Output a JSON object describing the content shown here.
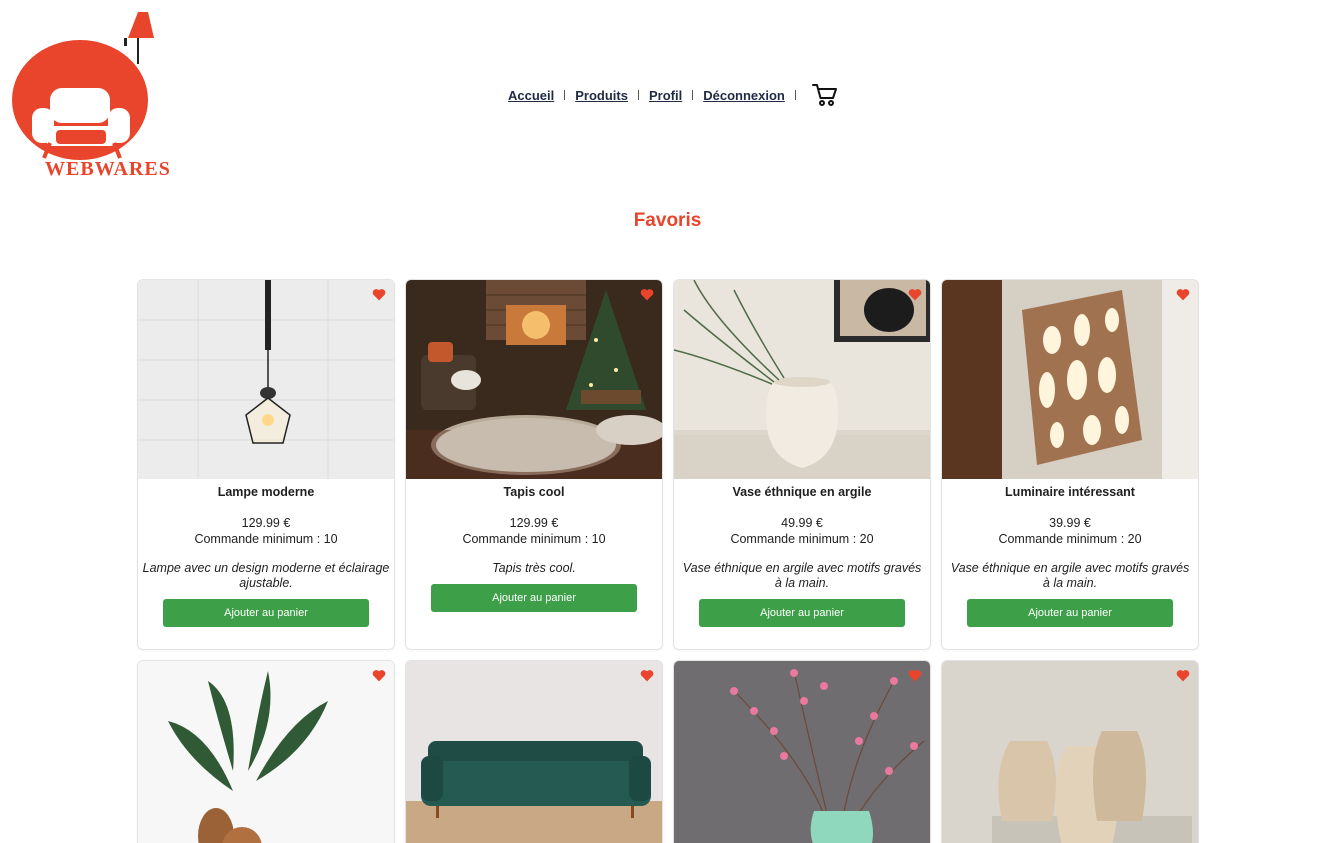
{
  "brand": {
    "name_part1": "WEB",
    "name_part2": "WARES",
    "accent": "#e8452c"
  },
  "nav": {
    "items": [
      {
        "label": "Accueil"
      },
      {
        "label": "Produits"
      },
      {
        "label": "Profil"
      },
      {
        "label": "Déconnexion"
      }
    ],
    "cart_icon": "cart-icon"
  },
  "page": {
    "title": "Favoris"
  },
  "products": [
    {
      "name": "Lampe moderne",
      "price": "129.99 €",
      "min_order": "Commande minimum : 10",
      "description": "Lampe avec un design moderne et éclairage ajustable.",
      "button": "Ajouter au panier",
      "favorite": true
    },
    {
      "name": "Tapis cool",
      "price": "129.99 €",
      "min_order": "Commande minimum : 10",
      "description": "Tapis très cool.",
      "button": "Ajouter au panier",
      "favorite": true
    },
    {
      "name": "Vase éthnique en argile",
      "price": "49.99 €",
      "min_order": "Commande minimum : 20",
      "description": "Vase éthnique en argile avec motifs gravés à la main.",
      "button": "Ajouter au panier",
      "favorite": true
    },
    {
      "name": "Luminaire intéressant",
      "price": "39.99 €",
      "min_order": "Commande minimum : 20",
      "description": "Vase éthnique en argile avec motifs gravés à la main.",
      "button": "Ajouter au panier",
      "favorite": true
    }
  ],
  "button_color": "#3d9f48",
  "heart_color": "#e8452c"
}
